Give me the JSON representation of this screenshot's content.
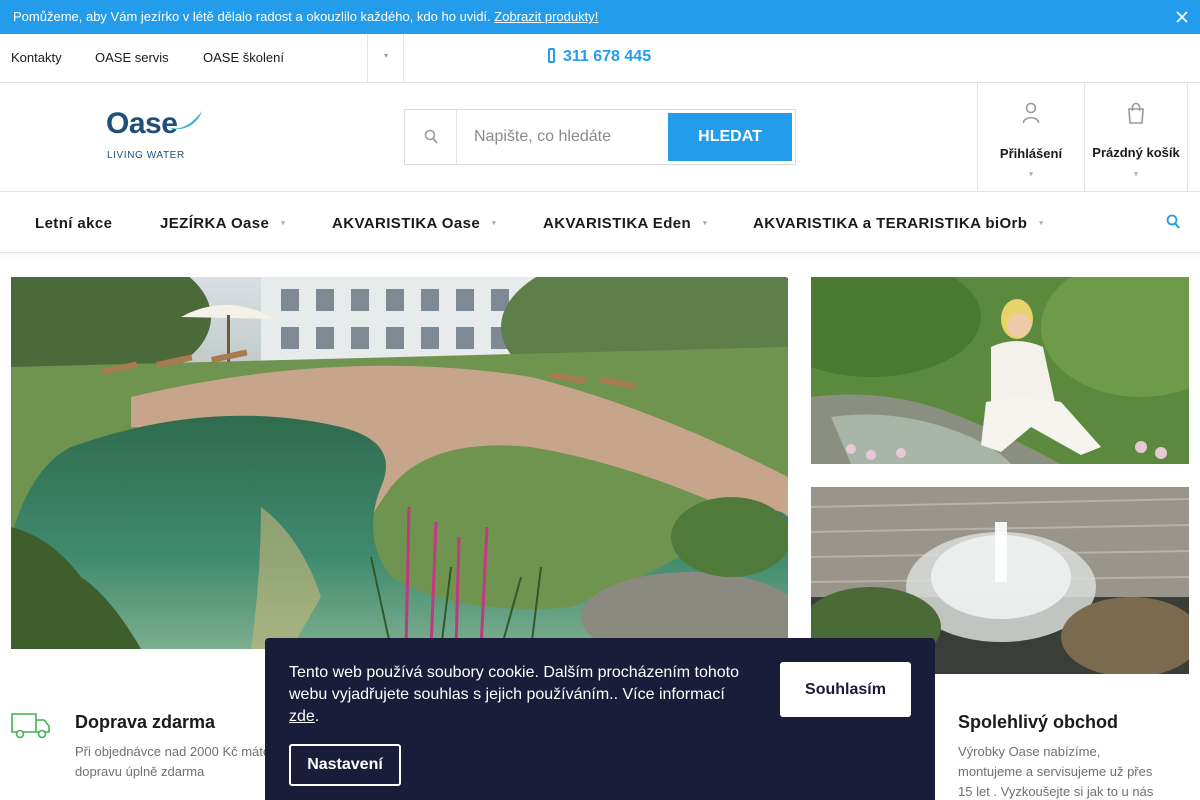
{
  "notice": {
    "text": "Pomůžeme, aby Vám jezírko v létě dělalo radost a okouzlilo každého, kdo ho uvidí.",
    "link": "Zobrazit produkty!"
  },
  "util": {
    "links": [
      "Kontakty",
      "OASE servis",
      "OASE školení"
    ],
    "phone": "311 678 445"
  },
  "logo": {
    "word": "Oase",
    "tagline": "LIVING WATER"
  },
  "search": {
    "placeholder": "Napište, co hledáte",
    "button": "HLEDAT"
  },
  "account": {
    "login": "Přihlášení",
    "cart": "Prázdný košík"
  },
  "nav": [
    "Letní akce",
    "JEZÍRKA Oase",
    "AKVARISTIKA Oase",
    "AKVARISTIKA Eden",
    "AKVARISTIKA a TERARISTIKA biOrb"
  ],
  "benefits": [
    {
      "title": "Doprava zdarma",
      "text": "Při objednávce nad 2000 Kč máte dopravu úplně zdarma"
    },
    {
      "title": "Spolehlivý obchod",
      "text": "Výrobky Oase nabízíme, montujeme a servisujeme už přes 15 let . Vyzkoušejte si jak to u nás"
    }
  ],
  "cookie": {
    "text": "Tento web používá soubory cookie. Dalším procházením tohoto webu vyjadřujete souhlas s jejich používáním.. Více informací",
    "link": "zde",
    "after": ".",
    "agree": "Souhlasím",
    "settings": "Nastavení"
  },
  "colors": {
    "accent": "#239ceb",
    "brand": "#1d4f7a",
    "cookie_bg": "#1a1d39"
  },
  "icons": [
    "close-icon",
    "chevron-down-icon",
    "phone-icon",
    "search-icon",
    "user-icon",
    "cart-icon",
    "truck-icon"
  ]
}
